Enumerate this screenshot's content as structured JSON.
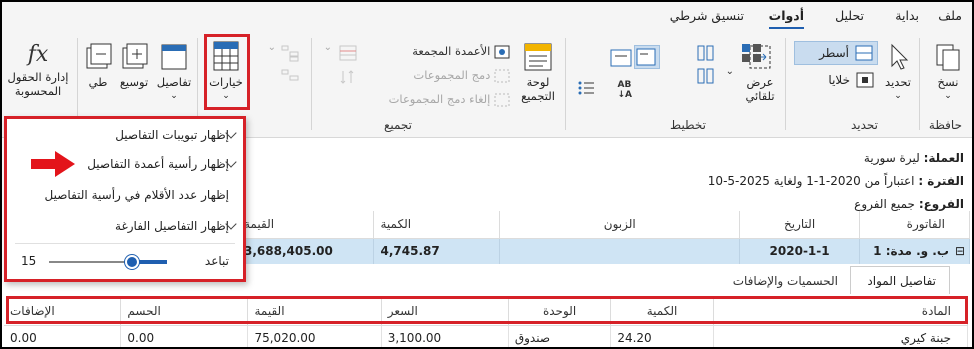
{
  "menu": {
    "file": "ملف",
    "home": "بداية",
    "analysis": "تحليل",
    "tools": "أدوات",
    "conditional": "تنسيق شرطي"
  },
  "ribbon": {
    "clipboard": {
      "label": "حافظة",
      "copy": "نسخ"
    },
    "select": {
      "label": "تحديد",
      "select_btn": "تحديد",
      "rows": "أسطر",
      "cells": "خلايا"
    },
    "layout": {
      "label": "تخطيط",
      "auto_width": "عرض تلقائي"
    },
    "grouping": {
      "label": "تجميع",
      "group_panel": "لوحة التجميع",
      "grouped_columns": "الأعمدة المجمعة",
      "merge_groups": "دمج المجموعات",
      "unmerge_groups": "إلغاء دمج المجموعات"
    },
    "options": "خيارات",
    "details": "تفاصيل",
    "expand": "توسيع",
    "collapse": "طي",
    "calc_fields": "إدارة الحقول المحسوبة"
  },
  "popup": {
    "show_detail_tabs": "إظهار تبويبات التفاصيل",
    "show_detail_col_headers": "إظهار رأسية أعمدة التفاصيل",
    "show_count_in_header": "إظهار عدد الأقلام في رأسية التفاصيل",
    "show_empty_details": "إظهار التفاصيل الفارغة",
    "spacing_label": "تباعد",
    "spacing_value": "15",
    "spacing_level": 0.3
  },
  "info": {
    "currency_label": "العملة:",
    "currency": "ليرة سورية",
    "period_label": "الفترة :",
    "period": "اعتباراً من 2020-1-1 ولغاية 2025-5-10",
    "branches_label": "الفروع:",
    "branches": "جميع الفروع"
  },
  "master": {
    "headers": [
      "الفاتورة",
      "التاريخ",
      "الزبون",
      "الكمية",
      "القيمة"
    ],
    "row": [
      "ب. و. مدة: 1",
      "2020-1-1",
      "",
      "4,745.87",
      "3,688,405.00"
    ],
    "expander": "⊟"
  },
  "tabs": {
    "items": "تفاصيل المواد",
    "discounts": "الحسميات والإضافات"
  },
  "detail": {
    "headers": [
      "المادة",
      "الكمية",
      "الوحدة",
      "السعر",
      "القيمة",
      "الحسم",
      "الإضافات"
    ],
    "row": [
      "جبنة كيري",
      "24.20",
      "صندوق",
      "3,100.00",
      "75,020.00",
      "0.00",
      "0.00"
    ]
  }
}
